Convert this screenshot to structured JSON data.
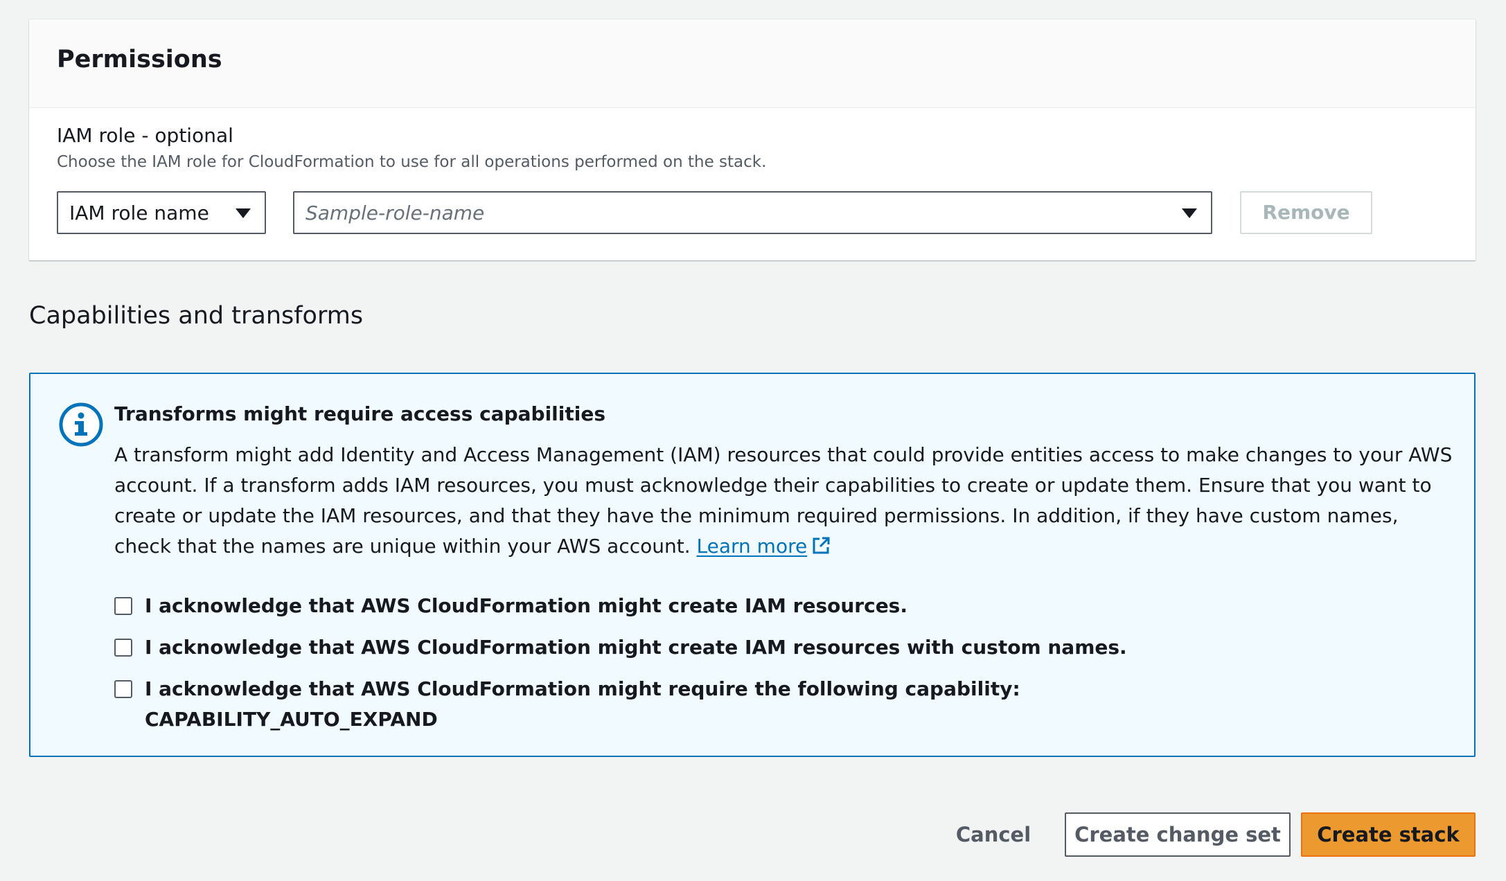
{
  "permissions": {
    "title": "Permissions",
    "iam_role": {
      "label": "IAM role - optional",
      "description": "Choose the IAM role for CloudFormation to use for all operations performed on the stack.",
      "type_select_value": "IAM role name",
      "role_placeholder": "Sample-role-name",
      "remove_label": "Remove"
    }
  },
  "capabilities": {
    "heading": "Capabilities and transforms",
    "alert": {
      "icon": "info-icon",
      "title": "Transforms might require access capabilities",
      "body": "A transform might add Identity and Access Management (IAM) resources that could provide entities access to make changes to your AWS account. If a transform adds IAM resources, you must acknowledge their capabilities to create or update them. Ensure that you want to create or update the IAM resources, and that they have the minimum required permissions. In addition, if they have custom names, check that the names are unique within your AWS account.",
      "learn_more": "Learn more",
      "checkboxes": [
        {
          "label": "I acknowledge that AWS CloudFormation might create IAM resources.",
          "checked": false
        },
        {
          "label": "I acknowledge that AWS CloudFormation might create IAM resources with custom names.",
          "checked": false
        },
        {
          "label": "I acknowledge that AWS CloudFormation might require the following capability:",
          "sublabel": "CAPABILITY_AUTO_EXPAND",
          "checked": false
        }
      ]
    }
  },
  "footer": {
    "cancel_label": "Cancel",
    "create_change_set_label": "Create change set",
    "create_stack_label": "Create stack"
  },
  "colors": {
    "accent_blue": "#0073bb",
    "primary_orange": "#ec7211",
    "page_background": "#f2f3f3",
    "alert_background": "#f1faff"
  }
}
